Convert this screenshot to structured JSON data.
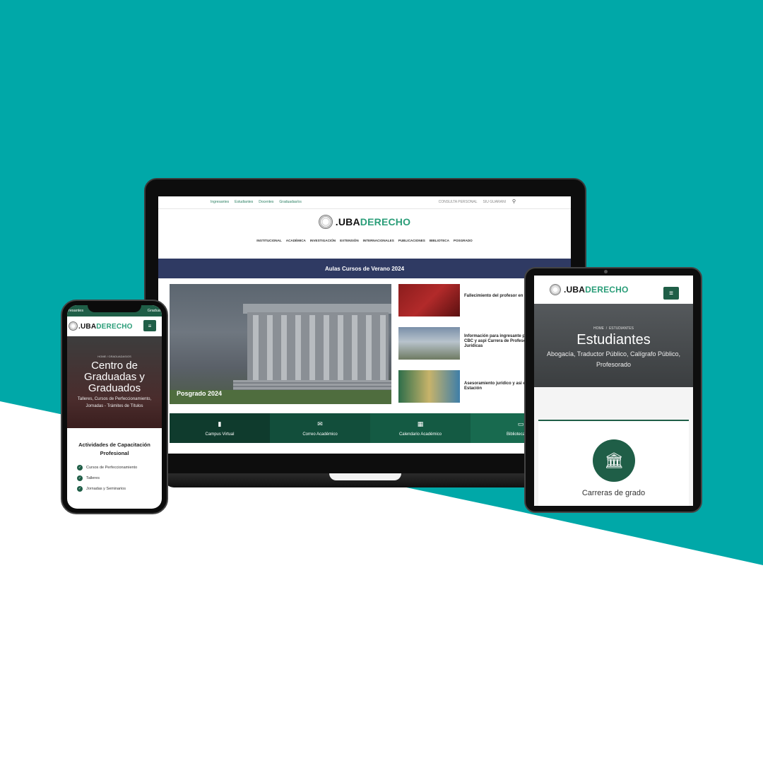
{
  "colors": {
    "teal": "#00a8a8",
    "green": "#1f5e47",
    "accent_green": "#2a9d78",
    "navy": "#2f3a63"
  },
  "brand": {
    "prefix": ".UBA",
    "suffix": "DERECHO"
  },
  "laptop": {
    "top_links": [
      "Ingresantes",
      "Estudiantes",
      "Docentes",
      "Graduadas/os"
    ],
    "top_right": [
      "CONSULTA PERSONAL",
      "SIU GUARANI"
    ],
    "nav": [
      "INSTITUCIONAL",
      "ACADÉMICA",
      "INVESTIGACIÓN",
      "EXTENSIÓN",
      "INTERNACIONALES",
      "PUBLICACIONES",
      "BIBLIOTECA",
      "POSGRADO"
    ],
    "banner": "Aulas Cursos de Verano 2024",
    "hero_caption": "Posgrado 2024",
    "news": [
      "Fallecimiento del profesor en Gordillo",
      "Información para ingresante provenientes del CBC y aspi Carrera de Profesorado en C Jurídicas",
      "Asesoramiento jurídico y asi en Parque de la Estación"
    ],
    "bar": [
      {
        "label": "Campus Virtual",
        "icon": "book-icon"
      },
      {
        "label": "Correo Académico",
        "icon": "mail-icon"
      },
      {
        "label": "Calendario Académico",
        "icon": "calendar-icon"
      },
      {
        "label": "Biblioteca Virtu",
        "icon": "monitor-icon"
      }
    ]
  },
  "tablet": {
    "crumb_home": "HOME",
    "crumb_current": "ESTUDIANTES",
    "title": "Estudiantes",
    "subtitle_1": "Abogacía, Traductor Público, Calígrafo Público,",
    "subtitle_2": "Profesorado",
    "card_title": "Carreras de grado"
  },
  "phone": {
    "top_left": "resantes",
    "top_right": "Gradua",
    "crumb_home": "HOME",
    "crumb_current": "GRADUADAS/OS",
    "title_1": "Centro de",
    "title_2": "Graduadas y",
    "title_3": "Graduados",
    "subtitle_1": "Talleres, Cursos de Perfeccionamiento,",
    "subtitle_2": "Jornadas - Trámites de Títulos",
    "section_1": "Actividades de Capacitación",
    "section_2": "Profesional",
    "items": [
      "Cursos de Perfeccionamiento",
      "Talleres",
      "Jornadas y Seminarios"
    ]
  }
}
